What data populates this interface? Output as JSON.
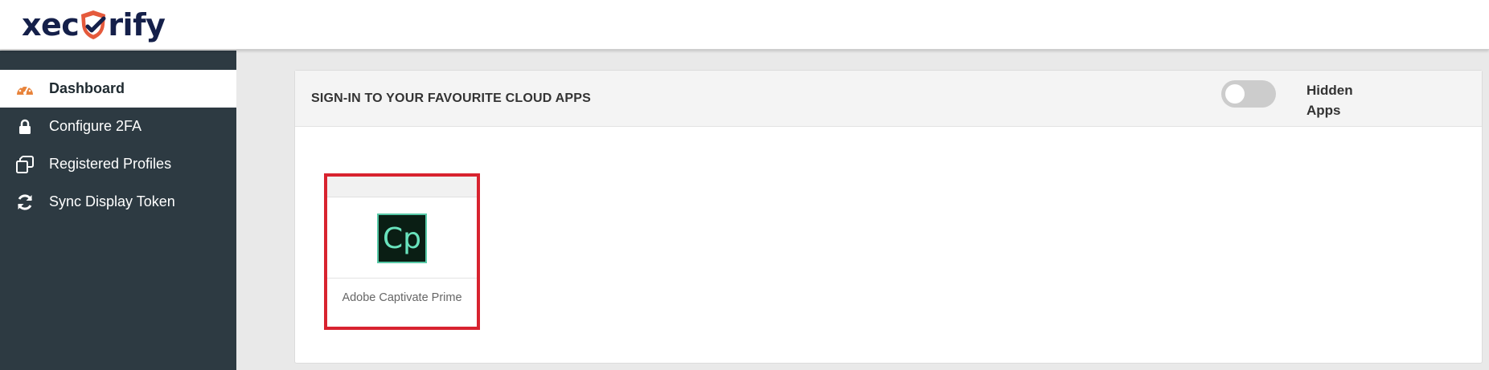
{
  "brand": {
    "logo_text_left": "xec",
    "logo_text_right": "rify",
    "shield_color": "#e55a3c"
  },
  "sidebar": {
    "items": [
      {
        "label": "Dashboard",
        "icon": "gauge-icon",
        "active": true
      },
      {
        "label": "Configure 2FA",
        "icon": "lock-icon",
        "active": false
      },
      {
        "label": "Registered Profiles",
        "icon": "copy-icon",
        "active": false
      },
      {
        "label": "Sync Display Token",
        "icon": "sync-icon",
        "active": false
      }
    ]
  },
  "main": {
    "card_title": "SIGN-IN TO YOUR FAVOURITE CLOUD APPS",
    "hidden_apps_toggle": {
      "label": "Hidden Apps",
      "on": false
    },
    "apps": [
      {
        "name": "Adobe Captivate Prime",
        "icon_text": "Cp",
        "highlighted": true
      }
    ]
  },
  "colors": {
    "sidebar_bg": "#2d3a42",
    "highlight_border": "#d8232f",
    "dashboard_icon": "#e8833a"
  }
}
